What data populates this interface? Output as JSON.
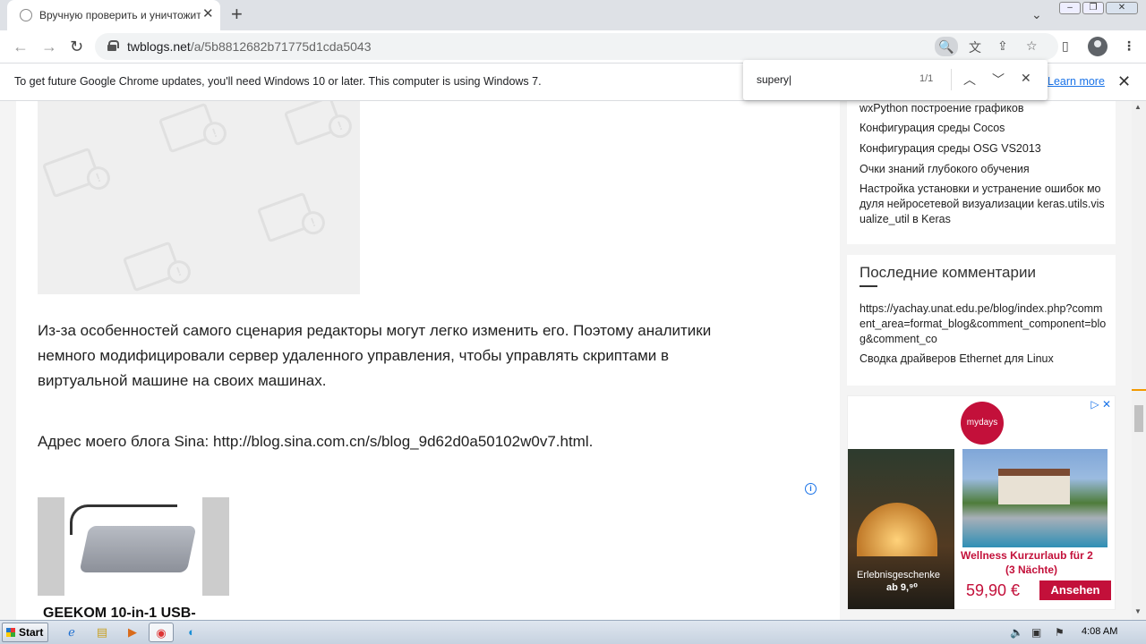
{
  "browser": {
    "tab_title": "Вручную проверить и уничтожить",
    "new_tab": "+",
    "url_host": "twblogs.net",
    "url_path": "/a/5b8812682b71775d1cda5043"
  },
  "infobar": {
    "message": "To get future Google Chrome updates, you'll need Windows 10 or later. This computer is using Windows 7.",
    "learn_more": "Learn more"
  },
  "findbar": {
    "query": "supery|",
    "count": "1/1"
  },
  "article": {
    "para1_line1": "Из-за особенностей самого сценария редакторы могут легко изменить его. Поэтому аналитики",
    "para1_line2": "немного модифицировали сервер удаленного управления, чтобы управлять скриптами в",
    "para1_line3": "виртуальной машине на своих машинах.",
    "para2": "Адрес моего блога Sina: http://blog.sina.com.cn/s/blog_9d62d0a50102w0v7.html.",
    "product_title": "GEEKOM 10-in-1 USB-"
  },
  "sidebar": {
    "related": [
      "wxPython построение графиков",
      "Конфигурация среды Cocos",
      "Конфигурация среды OSG VS2013",
      "Очки знаний глубокого обучения",
      "Настройка установки и устранение ошибок модуля нейросетевой визуализации keras.utils.visualize_util в Keras"
    ],
    "comments_title": "Последние комментарии",
    "comments": [
      "https://yachay.unat.edu.pe/blog/index.php?comment_area=format_blog&comment_component=blog&comment_co",
      "Сводка драйверов Ethernet для Linux"
    ]
  },
  "ad": {
    "brand": "mydays",
    "left_caption": "Erlebnisgeschenke",
    "left_price": "ab 9,⁹⁰",
    "title": "Wellness Kurzurlaub für 2",
    "subtitle": "(3 Nächte)",
    "price": "59,90 €",
    "cta": "Ansehen"
  },
  "taskbar": {
    "start": "Start",
    "time": "4:08 AM"
  }
}
